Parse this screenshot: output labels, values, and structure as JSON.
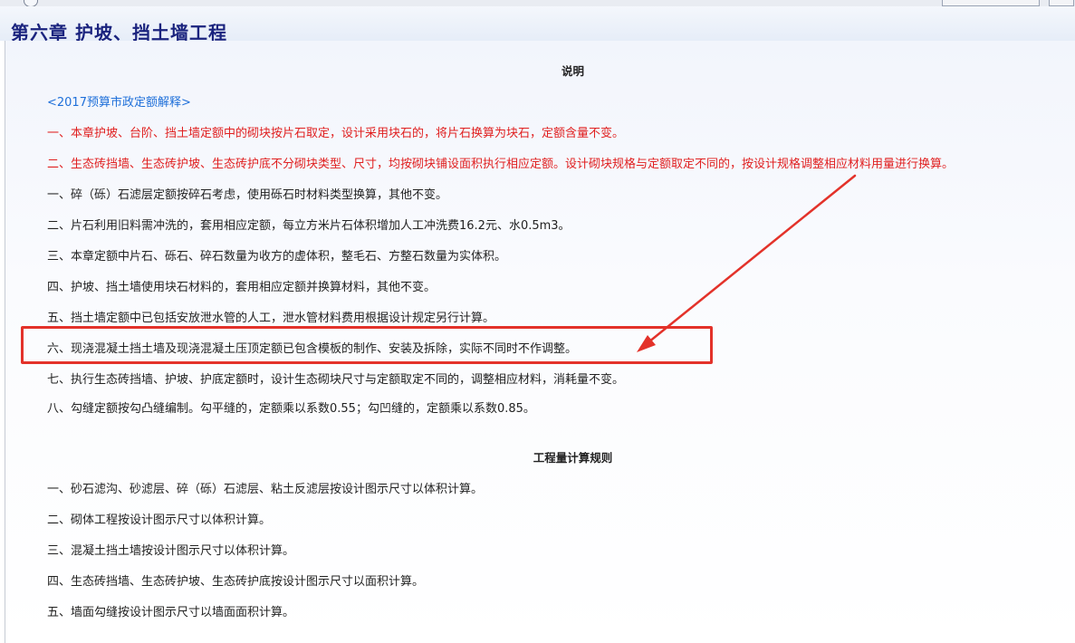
{
  "chapter_title": "第六章  护坡、挡土墙工程",
  "explanation": {
    "heading": "说明",
    "link_text": "<2017预算市政定额解释>",
    "red_notes": [
      "一、本章护坡、台阶、挡土墙定额中的砌块按片石取定，设计采用块石的，将片石换算为块石，定额含量不变。",
      "二、生态砖挡墙、生态砖护坡、生态砖护底不分砌块类型、尺寸，均按砌块铺设面积执行相应定额。设计砌块规格与定额取定不同的，按设计规格调整相应材料用量进行换算。"
    ],
    "items": [
      "一、碎（砾）石滤层定额按碎石考虑，使用砾石时材料类型换算，其他不变。",
      "二、片石利用旧料需冲洗的，套用相应定额，每立方米片石体积增加人工冲洗费16.2元、水0.5m3。",
      "三、本章定额中片石、砾石、碎石数量为收方的虚体积，整毛石、方整石数量为实体积。",
      "四、护坡、挡土墙使用块石材料的，套用相应定额并换算材料，其他不变。",
      "五、挡土墙定额中已包括安放泄水管的人工，泄水管材料费用根据设计规定另行计算。",
      "六、现浇混凝土挡土墙及现浇混凝土压顶定额已包含模板的制作、安装及拆除，实际不同时不作调整。",
      "七、执行生态砖挡墙、护坡、护底定额时，设计生态砌块尺寸与定额取定不同的，调整相应材料，消耗量不变。",
      "八、勾缝定额按勾凸缝编制。勾平缝的，定额乘以系数0.55；勾凹缝的，定额乘以系数0.85。"
    ]
  },
  "rules": {
    "heading": "工程量计算规则",
    "items": [
      "一、砂石滤沟、砂滤层、碎（砾）石滤层、粘土反滤层按设计图示尺寸以体积计算。",
      "二、砌体工程按设计图示尺寸以体积计算。",
      "三、混凝土挡土墙按设计图示尺寸以体积计算。",
      "四、生态砖挡墙、生态砖护坡、生态砖护底按设计图示尺寸以面积计算。",
      "五、墙面勾缝按设计图示尺寸以墙面面积计算。"
    ]
  },
  "annotation": {
    "color": "#e3322a"
  }
}
